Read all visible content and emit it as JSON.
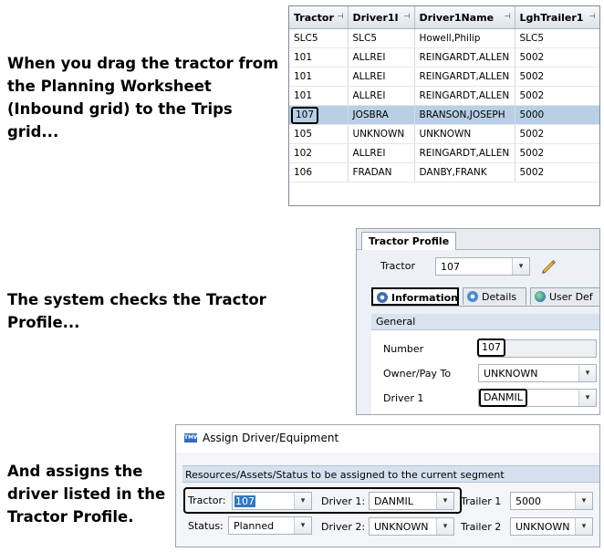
{
  "captions": {
    "drag": [
      "When you drag the tractor from",
      "the Planning Worksheet",
      "(Inbound grid) to the Trips",
      "grid..."
    ],
    "checks": [
      "The system checks the Tractor",
      "Profile..."
    ],
    "assigns": [
      "And assigns the",
      "driver listed in the",
      "Tractor Profile."
    ]
  },
  "grid": {
    "columns": [
      "Tractor",
      "Driver1I",
      "Driver1Name",
      "LghTrailer1"
    ],
    "pin_glyph": "⊣",
    "rows": [
      [
        "SLC5",
        "SLC5",
        "Howell,Philip",
        "SLC5"
      ],
      [
        "101",
        "ALLREI",
        "REINGARDT,ALLEN",
        "5002"
      ],
      [
        "101",
        "ALLREI",
        "REINGARDT,ALLEN",
        "5002"
      ],
      [
        "101",
        "ALLREI",
        "REINGARDT,ALLEN",
        "5002"
      ],
      [
        "107",
        "JOSBRA",
        "BRANSON,JOSEPH",
        "5000"
      ],
      [
        "105",
        "UNKNOWN",
        "UNKNOWN",
        "5002"
      ],
      [
        "102",
        "ALLREI",
        "REINGARDT,ALLEN",
        "5002"
      ],
      [
        "106",
        "FRADAN",
        "DANBY,FRANK",
        "5002"
      ]
    ],
    "selected_row_index": 4
  },
  "tractor_profile": {
    "tab": "Tractor Profile",
    "tractor_label": "Tractor",
    "tractor_value": "107",
    "subtabs": [
      "Information",
      "Details",
      "User Def"
    ],
    "section": "General",
    "number_label": "Number",
    "number_value": "107",
    "owner_label": "Owner/Pay To",
    "owner_value": "UNKNOWN",
    "driver1_label": "Driver 1",
    "driver1_value": "DANMIL"
  },
  "assign": {
    "title": "Assign Driver/Equipment",
    "logo_text": "TMW",
    "header": "Resources/Assets/Status to be assigned to the current segment",
    "tractor_label": "Tractor:",
    "tractor_value": "107",
    "driver1_label": "Driver 1:",
    "driver1_value": "DANMIL",
    "trailer1_label": "Trailer 1",
    "trailer1_value": "5000",
    "status_label": "Status:",
    "status_value": "Planned",
    "driver2_label": "Driver 2:",
    "driver2_value": "UNKNOWN",
    "trailer2_label": "Trailer 2",
    "trailer2_value": "UNKNOWN"
  },
  "icons": {
    "dropdown": "chevron-down-icon",
    "edit": "pencil-icon",
    "info": "info-icon",
    "details": "details-icon",
    "userdef": "globe-icon"
  },
  "colors": {
    "selected_row": "#b8cfe6",
    "section_header": "#d8e3ef",
    "highlight_box": "#000000",
    "selection": "#3178c6"
  }
}
